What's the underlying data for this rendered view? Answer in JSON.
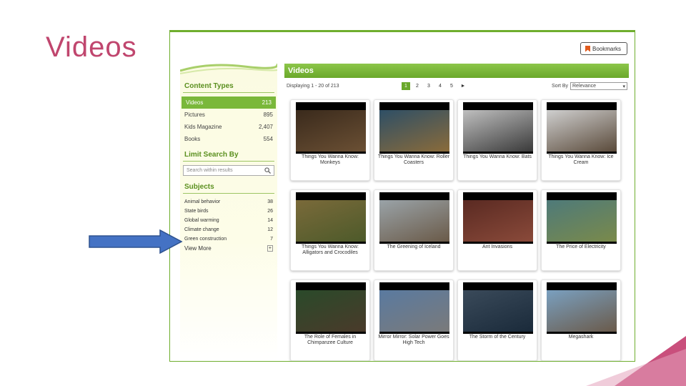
{
  "slide": {
    "title": "Videos"
  },
  "bookmarks": {
    "label": "Bookmarks"
  },
  "sidebar": {
    "content_types_heading": "Content Types",
    "content_types": [
      {
        "label": "Videos",
        "count": "213",
        "active": true
      },
      {
        "label": "Pictures",
        "count": "895"
      },
      {
        "label": "Kids Magazine",
        "count": "2,407"
      },
      {
        "label": "Books",
        "count": "554"
      }
    ],
    "limit_heading": "Limit Search By",
    "search_placeholder": "Search within results",
    "subjects_heading": "Subjects",
    "subjects": [
      {
        "label": "Animal behavior",
        "count": "38"
      },
      {
        "label": "State birds",
        "count": "26"
      },
      {
        "label": "Global warming",
        "count": "14"
      },
      {
        "label": "Climate change",
        "count": "12"
      },
      {
        "label": "Green construction",
        "count": "7"
      }
    ],
    "view_more": "View More"
  },
  "main": {
    "header": "Videos",
    "displaying": "Displaying 1 - 20 of 213",
    "pages": [
      "1",
      "2",
      "3",
      "4",
      "5",
      "►"
    ],
    "sort_label": "Sort By",
    "sort_value": "Relevance",
    "videos": [
      {
        "title": "Things You Wanna Know: Monkeys",
        "colors": [
          "#3a2a1c",
          "#6b5034"
        ]
      },
      {
        "title": "Things You Wanna Know: Roller Coasters",
        "colors": [
          "#2e4f66",
          "#8a6b3a"
        ]
      },
      {
        "title": "Things You Wanna Know: Bats",
        "colors": [
          "#bfbfbf",
          "#3a3a3a"
        ]
      },
      {
        "title": "Things You Wanna Know: Ice Cream",
        "colors": [
          "#cfcfcf",
          "#5a4a3a"
        ]
      },
      {
        "title": "Things You Wanna Know: Alligators and Crocodiles",
        "colors": [
          "#7a6a3a",
          "#4d5a2a"
        ]
      },
      {
        "title": "The Greening of Iceland",
        "colors": [
          "#9aa3a8",
          "#6a5a48"
        ]
      },
      {
        "title": "Ant Invasions",
        "colors": [
          "#5a2a22",
          "#8a4a3a"
        ]
      },
      {
        "title": "The Price of Electricity",
        "colors": [
          "#4e7a7a",
          "#7a8a4a"
        ]
      },
      {
        "title": "The Role of Females in Chimpanzee Culture",
        "colors": [
          "#2a4a2a",
          "#4a3a2a"
        ]
      },
      {
        "title": "Mirror Mirror: Solar Power Goes High Tech",
        "colors": [
          "#5a7aa0",
          "#7a7a7a"
        ]
      },
      {
        "title": "The Storm of the Century",
        "colors": [
          "#3a4a5a",
          "#1a2a3a"
        ]
      },
      {
        "title": "Megashark",
        "colors": [
          "#7aa0c0",
          "#6a5a4a"
        ]
      }
    ]
  },
  "colors": {
    "accent": "#6aa82a",
    "title": "#c0466e",
    "arrow": "#3c6cc4"
  }
}
